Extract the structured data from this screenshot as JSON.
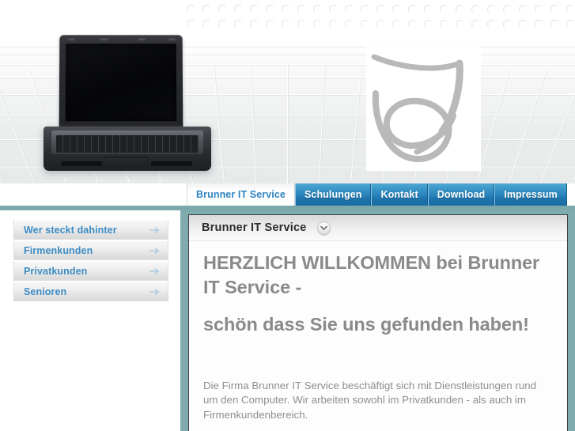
{
  "header": {
    "logo_alt": "JB monogram logo",
    "laptop_alt": "black notebook computer"
  },
  "nav": {
    "tabs": [
      {
        "label": "Brunner IT Service",
        "active": true
      },
      {
        "label": "Schulungen",
        "active": false
      },
      {
        "label": "Kontakt",
        "active": false
      },
      {
        "label": "Download",
        "active": false
      },
      {
        "label": "Impressum",
        "active": false
      }
    ]
  },
  "sidebar": {
    "items": [
      {
        "label": "Wer steckt dahinter"
      },
      {
        "label": "Firmenkunden"
      },
      {
        "label": "Privatkunden"
      },
      {
        "label": "Senioren"
      }
    ]
  },
  "content": {
    "panel_title": "Brunner IT Service",
    "collapse_icon": "chevron-down-icon",
    "headline_1": "HERZLICH WILLKOMMEN bei Brunner IT Service -",
    "headline_2": "schön dass Sie uns gefunden haben!",
    "paragraph": "Die Firma Brunner IT Service beschäftigt sich mit Dienstleistungen rund um den Computer. Wir arbeiten sowohl im  Privatkunden - als auch im Firmenkundenbereich."
  },
  "colors": {
    "nav_blue": "#2a85bb",
    "nav_active_text": "#3d8cc4",
    "frame_teal": "#7fabae",
    "heading_gray": "#8a8a8a",
    "sidebar_link": "#3d8cc4"
  }
}
